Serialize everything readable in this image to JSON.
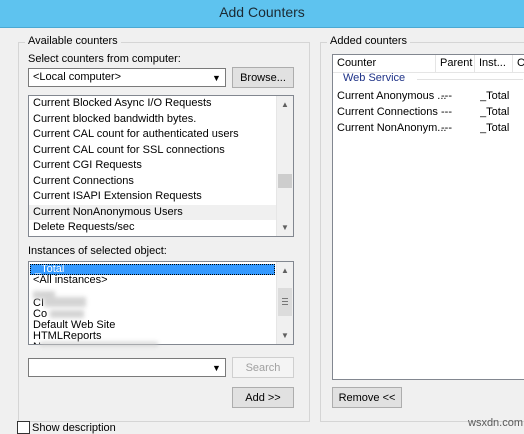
{
  "window": {
    "title": "Add Counters"
  },
  "available": {
    "group_label": "Available counters",
    "computer_label": "Select counters from computer:",
    "computer_value": "<Local computer>",
    "browse_label": "Browse...",
    "counters": [
      "Current Blocked Async I/O Requests",
      "Current blocked bandwidth bytes.",
      "Current CAL count for authenticated users",
      "Current CAL count for SSL connections",
      "Current CGI Requests",
      "Current Connections",
      "Current ISAPI Extension Requests",
      "Current NonAnonymous Users",
      "Delete Requests/sec"
    ],
    "instances_label": "Instances of selected object:",
    "instances": [
      "_Total",
      "<All instances>",
      "",
      "CI",
      "Co",
      "Default Web Site",
      "HTMLReports",
      "N"
    ],
    "search_value": "",
    "search_label": "Search",
    "add_label": "Add >>"
  },
  "added": {
    "group_label": "Added counters",
    "columns": [
      "Counter",
      "Parent",
      "Inst...",
      "Co"
    ],
    "group_name": "Web Service",
    "rows": [
      {
        "counter": "Current Anonymous ...",
        "parent": "---",
        "instance": "_Total"
      },
      {
        "counter": "Current Connections",
        "parent": "---",
        "instance": "_Total"
      },
      {
        "counter": "Current NonAnonym...",
        "parent": "---",
        "instance": "_Total"
      }
    ],
    "remove_label": "Remove <<"
  },
  "footer": {
    "show_description_label": "Show description"
  },
  "watermark": "wsxdn.com",
  "colors": {
    "titlebar": "#5ec3ef",
    "selection": "#3399ff",
    "group_text": "#1e3287"
  },
  "icons": {
    "dropdown": "chevron-down-icon",
    "scroll_up": "scroll-up-icon",
    "scroll_down": "scroll-down-icon"
  }
}
